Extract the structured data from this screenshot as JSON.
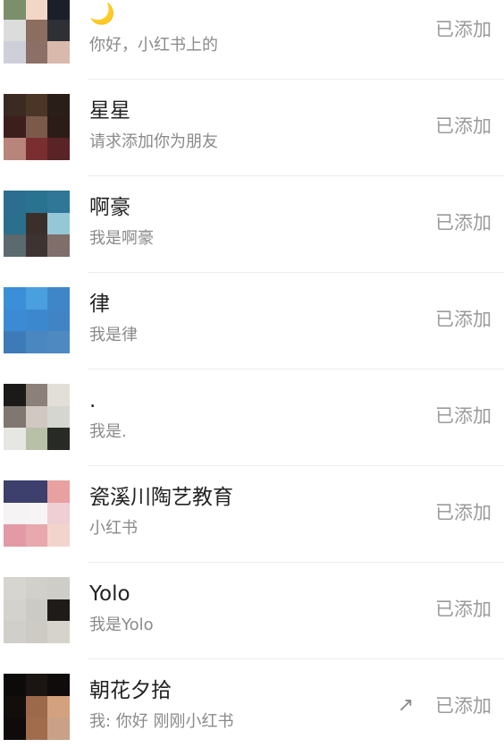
{
  "friend_requests": [
    {
      "name": "🌙",
      "message": "你好，小红书上的",
      "status": "已添加",
      "avatar_colors": [
        "#7a8f6a",
        "#f3d7c6",
        "#1b1f2a",
        "#dcdcdc",
        "#8b6e5f",
        "#2f3036",
        "#cfcfd9",
        "#8c6f66",
        "#d9b9ab"
      ]
    },
    {
      "name": "星星",
      "message": "请求添加你为朋友",
      "status": "已添加",
      "avatar_colors": [
        "#3a2a22",
        "#4a3526",
        "#2a1e18",
        "#3c1f1c",
        "#7b5a4a",
        "#2c1c17",
        "#b98479",
        "#7a2e30",
        "#5a2326"
      ]
    },
    {
      "name": "啊豪",
      "message": "我是啊豪",
      "status": "已添加",
      "avatar_colors": [
        "#2b6e8f",
        "#2a7390",
        "#2f7697",
        "#2a6f8e",
        "#3b2f2c",
        "#95c8d6",
        "#5a6a6f",
        "#3d3331",
        "#7f6e69"
      ]
    },
    {
      "name": "律",
      "message": "我是律",
      "status": "已添加",
      "avatar_colors": [
        "#3a8fd8",
        "#4aa0de",
        "#3f86c8",
        "#3a8bd4",
        "#3b88cf",
        "#4184c6",
        "#3d7ab8",
        "#4a86c0",
        "#4f89c2"
      ]
    },
    {
      "name": ".",
      "message": "我是.",
      "status": "已添加",
      "avatar_colors": [
        "#1c1a18",
        "#8b807a",
        "#e1dfd8",
        "#7f7770",
        "#d0c8c1",
        "#d6d6d0",
        "#e6e6e3",
        "#b9c0a8",
        "#272a25"
      ]
    },
    {
      "name": "瓷溪川陶艺教育",
      "message": "小红书",
      "status": "已添加",
      "avatar_colors": [
        "#3d3f6c",
        "#3d3f6c",
        "#e8a0a0",
        "#f6f3f4",
        "#f7f4f5",
        "#efcfd4",
        "#e39aa6",
        "#e8a8ae",
        "#f3d4cc"
      ]
    },
    {
      "name": "Yolo",
      "message": "我是Yolo",
      "status": "已添加",
      "avatar_colors": [
        "#d7d5cf",
        "#d2d0ca",
        "#cfcdc7",
        "#d4d2cc",
        "#cccac4",
        "#1e1b19",
        "#d1cfc9",
        "#cecbc5",
        "#d6d3cd"
      ]
    },
    {
      "name": "朝花夕拾",
      "message": "我: 你好 刚刚小红书",
      "status": "已添加",
      "share_icon": "share-arrow-icon",
      "avatar_colors": [
        "#0d0b0a",
        "#1a1412",
        "#0f0c0b",
        "#120e0c",
        "#9c6a4a",
        "#d4a17e",
        "#0e0b0a",
        "#a06c4c",
        "#c9a186"
      ]
    }
  ]
}
